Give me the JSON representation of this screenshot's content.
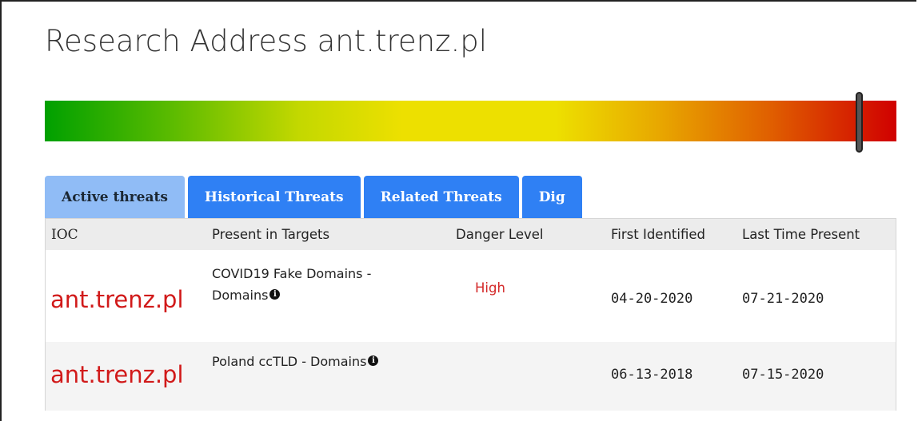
{
  "page": {
    "title": "Research Address ant.trenz.pl"
  },
  "gauge": {
    "level_fraction": 0.956,
    "colors": {
      "low": "#00a000",
      "mid": "#ede000",
      "high": "#d00000"
    }
  },
  "tabs": [
    {
      "label": "Active threats",
      "active": true
    },
    {
      "label": "Historical Threats",
      "active": false
    },
    {
      "label": "Related Threats",
      "active": false
    },
    {
      "label": "Dig",
      "active": false
    }
  ],
  "table": {
    "headers": {
      "ioc": "IOC",
      "targets": "Present in Targets",
      "danger": "Danger Level",
      "first": "First Identified",
      "last": "Last Time Present"
    },
    "rows": [
      {
        "ioc": "ant.trenz.pl",
        "target_line1": "COVID19 Fake Domains -",
        "target_line2": "Domains",
        "danger": "High",
        "first": "04-20-2020",
        "last": "07-21-2020"
      },
      {
        "ioc": "ant.trenz.pl",
        "target_line1": "Poland ccTLD - Domains",
        "target_line2": "",
        "danger": "",
        "first": "06-13-2018",
        "last": "07-15-2020"
      }
    ]
  },
  "icons": {
    "info": "info-icon",
    "info_glyph": "i"
  },
  "colors": {
    "tab_active": "#90bcf6",
    "tab_inactive": "#2f80f4",
    "ioc_text": "#d11a1a",
    "danger_high": "#d42a2a"
  }
}
